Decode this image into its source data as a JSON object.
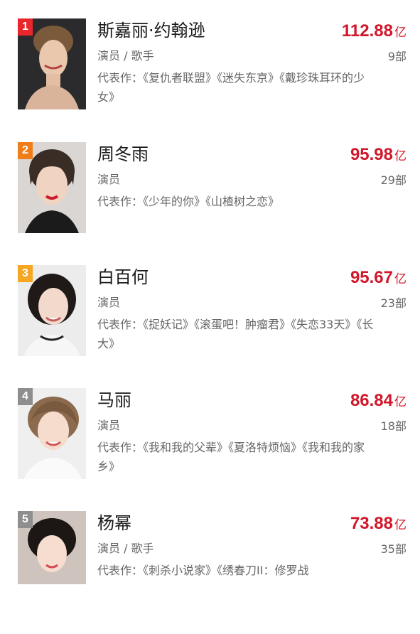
{
  "items": [
    {
      "rank": "1",
      "name": "斯嘉丽·约翰逊",
      "score": "112.88",
      "unit": "亿",
      "role": "演员 / 歌手",
      "count": "9部",
      "works": "代表作：《复仇者联盟》《迷失东京》《戴珍珠耳环的少女》",
      "badge_color": "#e8262c"
    },
    {
      "rank": "2",
      "name": "周冬雨",
      "score": "95.98",
      "unit": "亿",
      "role": "演员",
      "count": "29部",
      "works": "代表作：《少年的你》《山楂树之恋》",
      "badge_color": "#f07d18"
    },
    {
      "rank": "3",
      "name": "白百何",
      "score": "95.67",
      "unit": "亿",
      "role": "演员",
      "count": "23部",
      "works": "代表作：《捉妖记》《滚蛋吧！肿瘤君》《失恋33天》《长大》",
      "badge_color": "#f5a623"
    },
    {
      "rank": "4",
      "name": "马丽",
      "score": "86.84",
      "unit": "亿",
      "role": "演员",
      "count": "18部",
      "works": "代表作：《我和我的父辈》《夏洛特烦恼》《我和我的家乡》",
      "badge_color": "#8e8e8e"
    },
    {
      "rank": "5",
      "name": "杨幂",
      "score": "73.88",
      "unit": "亿",
      "role": "演员 / 歌手",
      "count": "35部",
      "works": "代表作：《刺杀小说家》《绣春刀II：修罗战",
      "badge_color": "#8e8e8e"
    }
  ],
  "colors": {
    "score": "#d1182b",
    "secondary_text": "#666666"
  }
}
